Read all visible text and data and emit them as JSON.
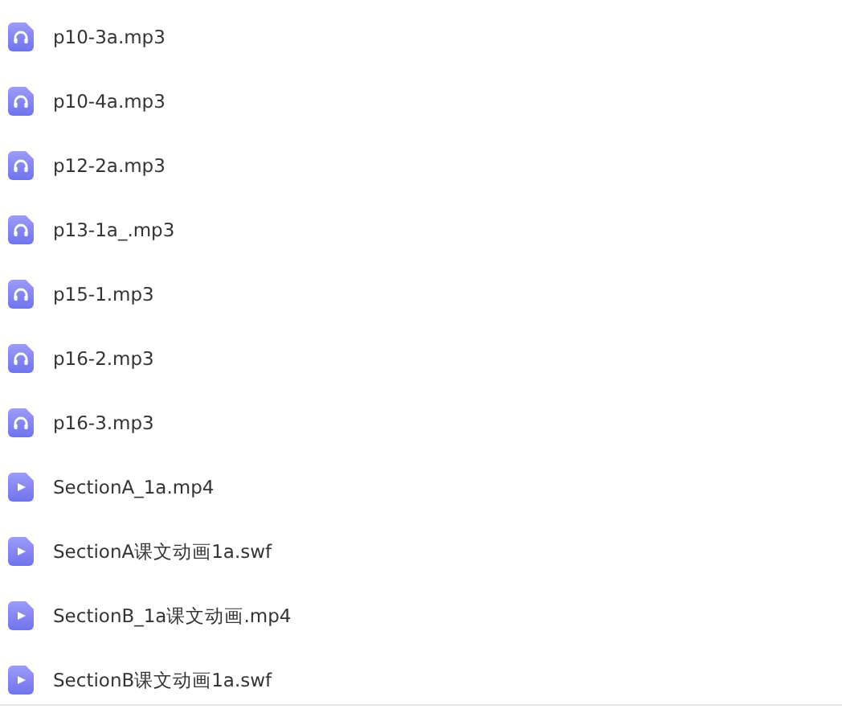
{
  "files": [
    {
      "name": "p10-3a.mp3",
      "kind": "audio"
    },
    {
      "name": "p10-4a.mp3",
      "kind": "audio"
    },
    {
      "name": "p12-2a.mp3",
      "kind": "audio"
    },
    {
      "name": "p13-1a_.mp3",
      "kind": "audio"
    },
    {
      "name": "p15-1.mp3",
      "kind": "audio"
    },
    {
      "name": "p16-2.mp3",
      "kind": "audio"
    },
    {
      "name": "p16-3.mp3",
      "kind": "audio"
    },
    {
      "name": "SectionA_1a.mp4",
      "kind": "video"
    },
    {
      "name": "SectionA课文动画1a.swf",
      "kind": "video"
    },
    {
      "name": "SectionB_1a课文动画.mp4",
      "kind": "video"
    },
    {
      "name": "SectionB课文动画1a.swf",
      "kind": "video"
    }
  ]
}
